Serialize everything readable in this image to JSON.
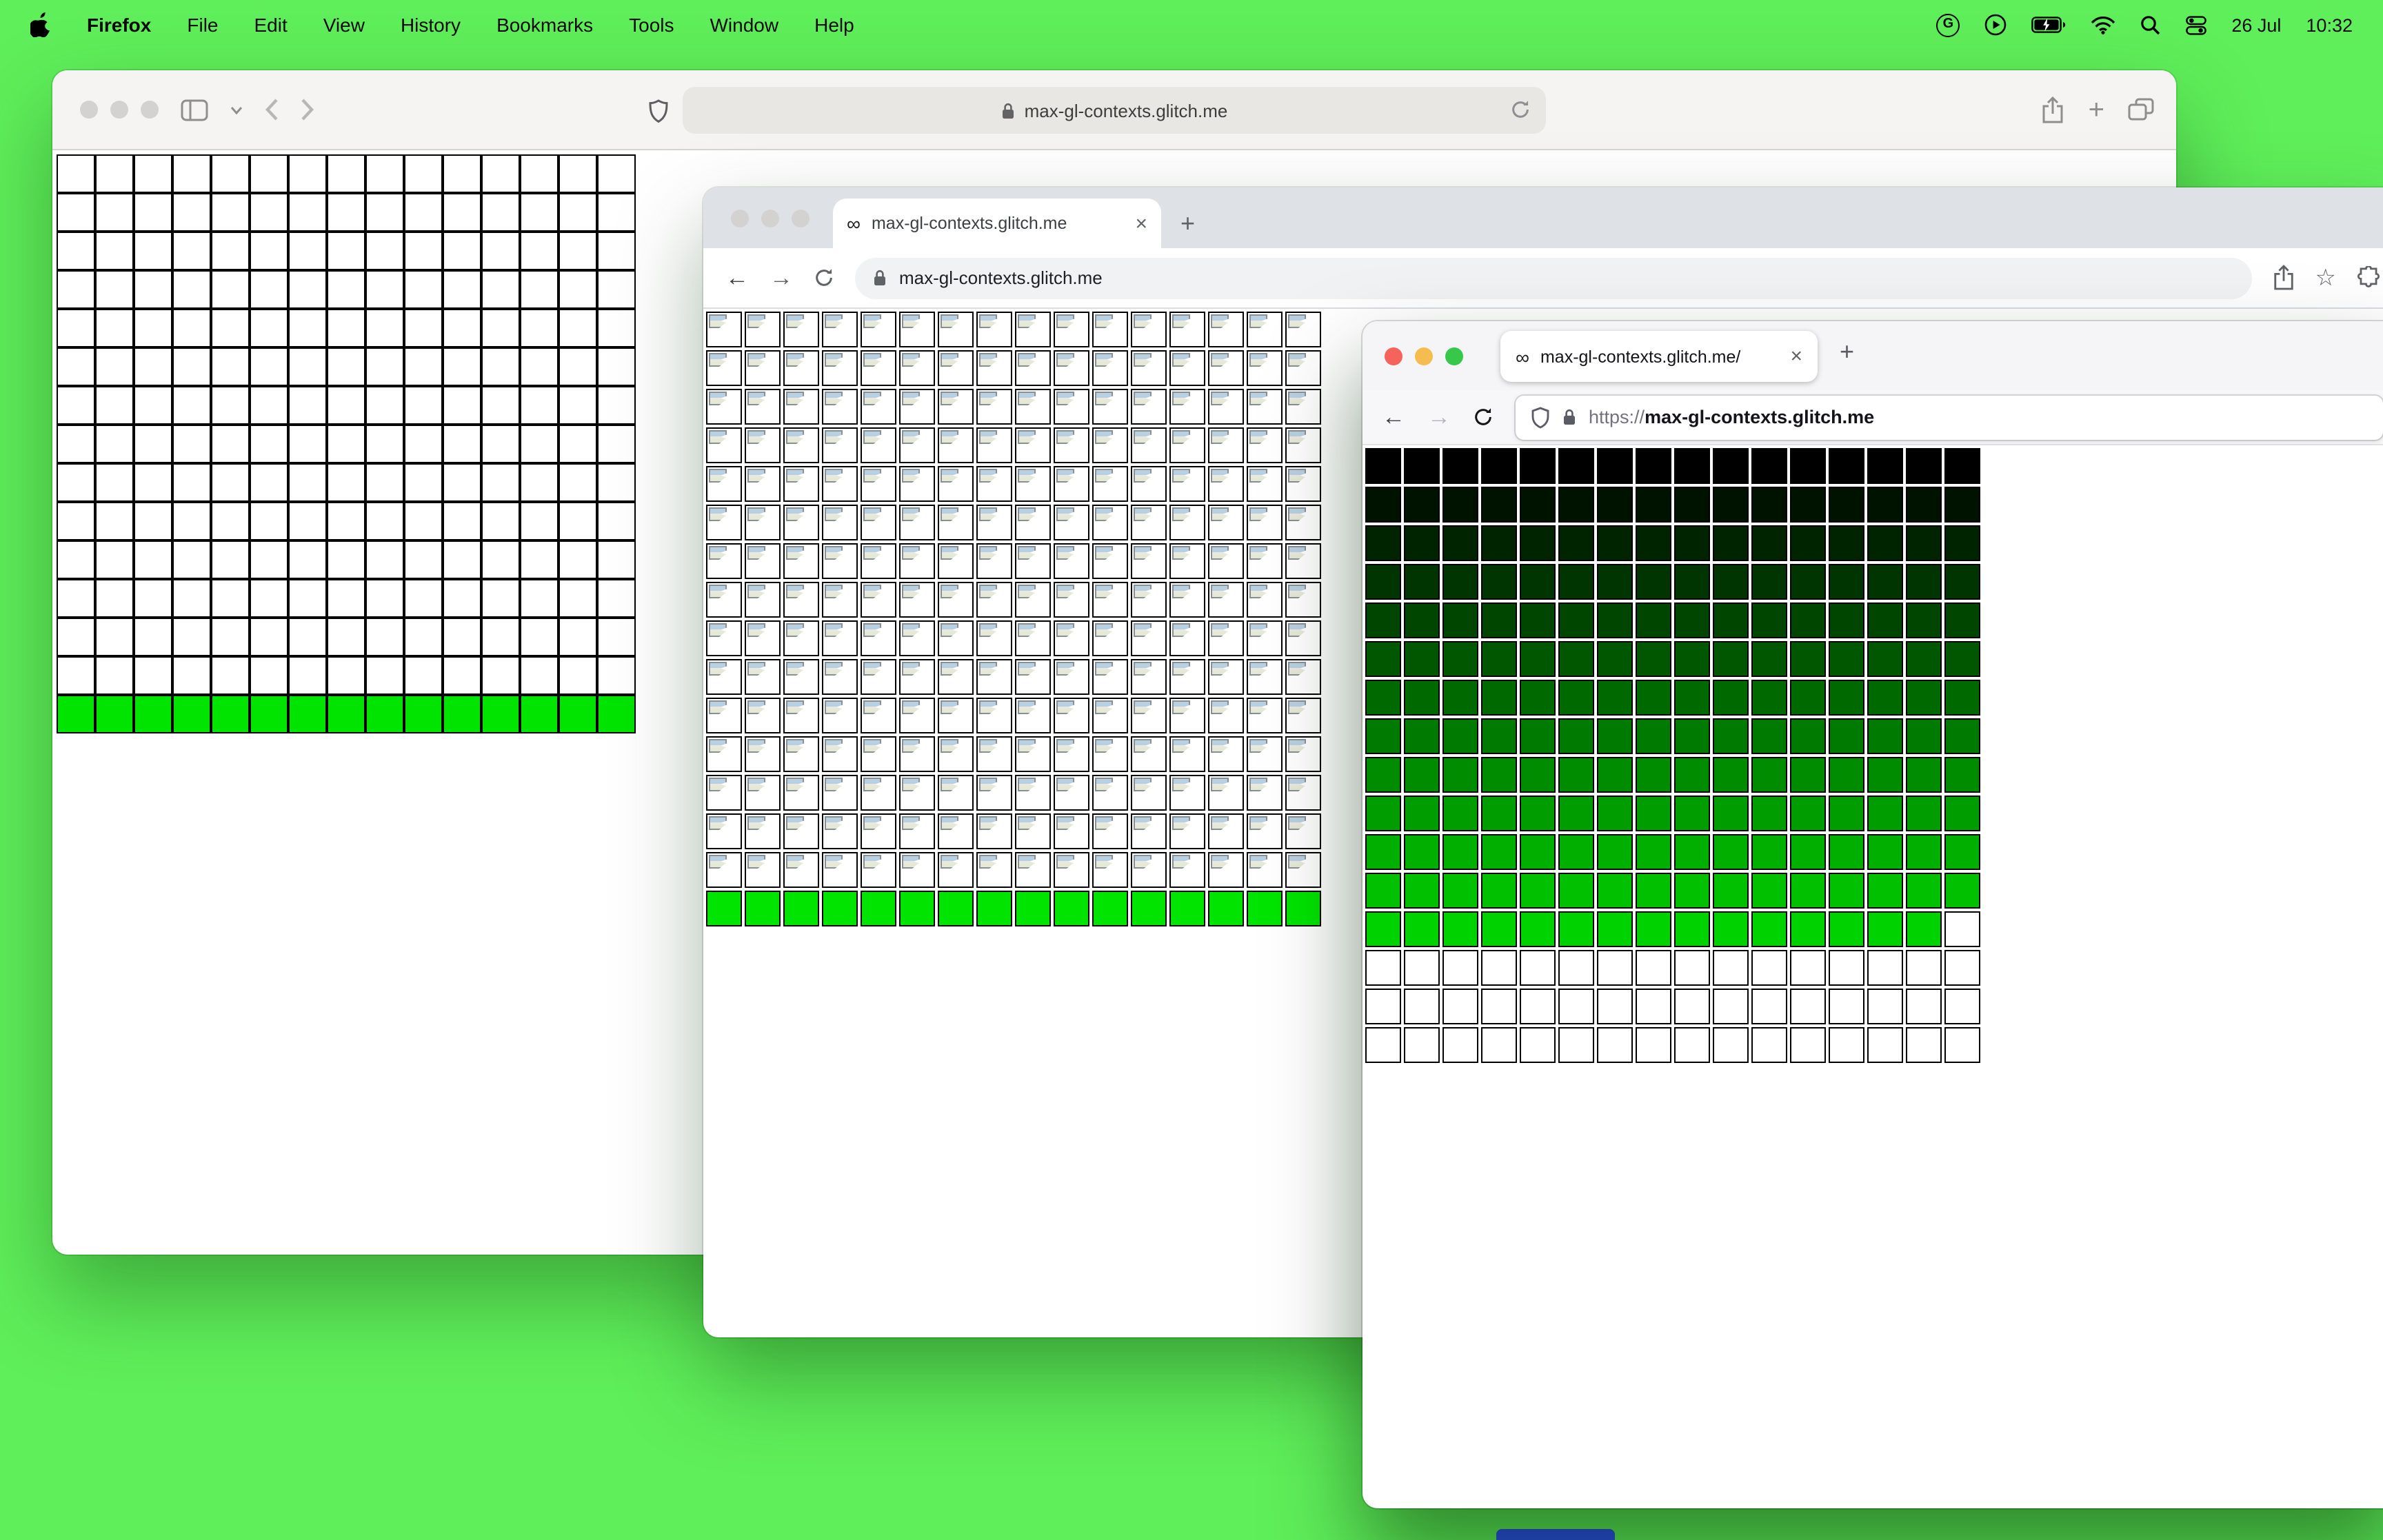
{
  "desktop": {
    "background_color": "#5FEF5A",
    "dock_peek_color": "#2B4BF2"
  },
  "menu_bar": {
    "app_name": "Firefox",
    "items": [
      "File",
      "Edit",
      "View",
      "History",
      "Bookmarks",
      "Tools",
      "Window",
      "Help"
    ],
    "grammarly_glyph": "G",
    "date": "26 Jul",
    "time": "10:32"
  },
  "glyphs": {
    "infinity": "∞",
    "close": "×",
    "plus": "+",
    "star": "☆",
    "back_arrow": "←",
    "forward_arrow": "→"
  },
  "safari": {
    "url": "max-gl-contexts.glitch.me"
  },
  "chrome": {
    "tab_title": "max-gl-contexts.glitch.me",
    "url": "max-gl-contexts.glitch.me"
  },
  "firefox": {
    "tab_title": "max-gl-contexts.glitch.me/",
    "url_scheme": "https://",
    "url_host": "max-gl-contexts.glitch.me"
  },
  "grids": {
    "safari": {
      "cols": 15,
      "rows_spec": [
        {
          "count": 14,
          "fill": "#ffffff"
        },
        {
          "count": 1,
          "fill": "#00E400"
        }
      ]
    },
    "chrome": {
      "cols": 16,
      "rows_spec": [
        {
          "count": 15,
          "fill": "#ffffff",
          "type": "broken-image"
        },
        {
          "count": 1,
          "fill": "#00E400"
        }
      ]
    },
    "firefox": {
      "cols": 16,
      "rows_spec": [
        {
          "count": 1,
          "fill": "#000000"
        },
        {
          "count": 1,
          "fill": "#001200"
        },
        {
          "count": 1,
          "fill": "#002300"
        },
        {
          "count": 1,
          "fill": "#003400"
        },
        {
          "count": 1,
          "fill": "#004600"
        },
        {
          "count": 1,
          "fill": "#005700"
        },
        {
          "count": 1,
          "fill": "#006900"
        },
        {
          "count": 1,
          "fill": "#007A00"
        },
        {
          "count": 1,
          "fill": "#008C00"
        },
        {
          "count": 1,
          "fill": "#009D00"
        },
        {
          "count": 1,
          "fill": "#00AF00"
        },
        {
          "count": 1,
          "fill": "#00C000"
        },
        {
          "count": 1,
          "fill": "#00D200",
          "last_cell_fill": "#ffffff"
        },
        {
          "count": 3,
          "fill": "#ffffff"
        }
      ]
    }
  }
}
